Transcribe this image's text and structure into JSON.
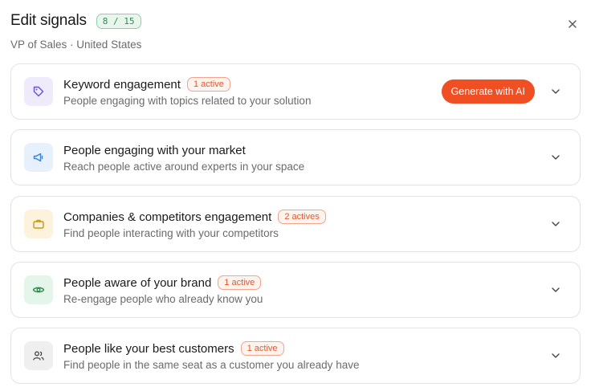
{
  "header": {
    "title": "Edit signals",
    "counter": "8 / 15",
    "subtitle": "VP of Sales · United States",
    "close_icon": "close-icon"
  },
  "colors": {
    "accent": "#f04e23",
    "counter_green": "#2f8a4f",
    "badge_orange": "#e4572e"
  },
  "signals": [
    {
      "name": "Keyword engagement",
      "badge": "1 active",
      "description": "People engaging with topics related to your solution",
      "icon": "tag-icon",
      "action": "Generate with AI"
    },
    {
      "name": "People engaging with your market",
      "badge": "",
      "description": "Reach people active around experts in your space",
      "icon": "megaphone-icon"
    },
    {
      "name": "Companies & competitors engagement",
      "badge": "2 actives",
      "description": "Find people interacting with your competitors",
      "icon": "briefcase-icon"
    },
    {
      "name": "People aware of your brand",
      "badge": "1 active",
      "description": "Re-engage people who already know you",
      "icon": "eye-icon"
    },
    {
      "name": "People like your best customers",
      "badge": "1 active",
      "description": "Find people in the same seat as a customer you already have",
      "icon": "users-icon"
    }
  ]
}
